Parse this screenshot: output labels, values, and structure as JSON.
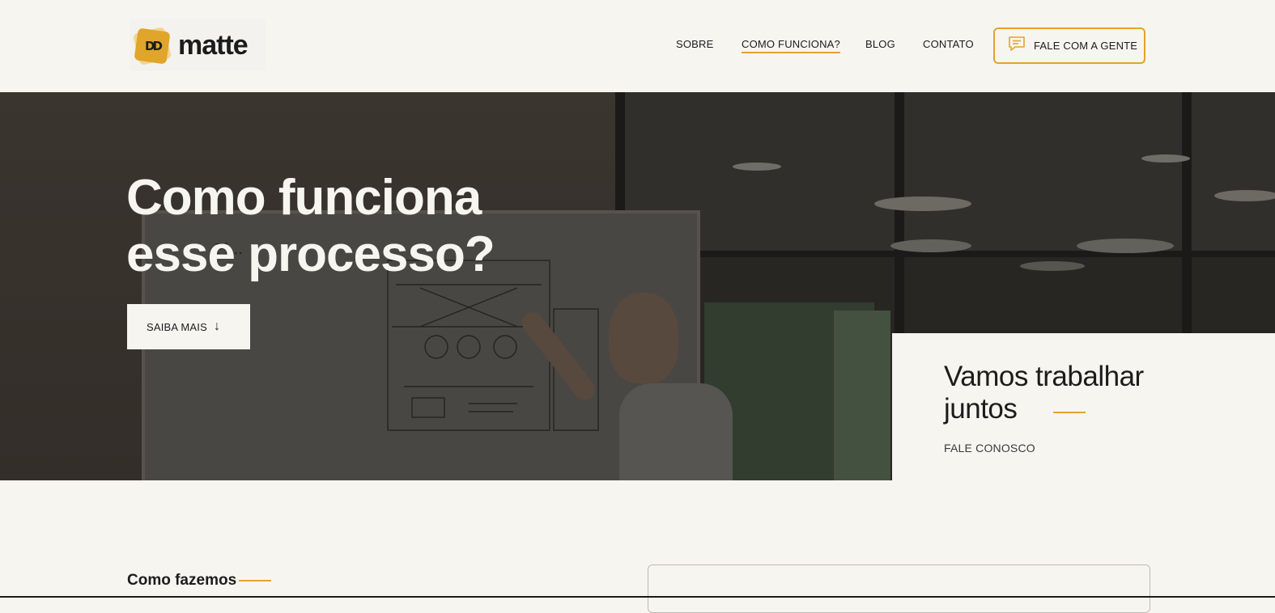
{
  "brand": {
    "name": "matte",
    "mark_text": "DD",
    "accent_color": "#e0a52a",
    "background_color": "#f7f5f0"
  },
  "nav": {
    "items": [
      {
        "label": "SOBRE",
        "active": false
      },
      {
        "label": "COMO FUNCIONA?",
        "active": true
      },
      {
        "label": "BLOG",
        "active": false
      },
      {
        "label": "CONTATO",
        "active": false
      }
    ],
    "cta": {
      "label": "FALE COM A GENTE",
      "icon": "chat-bubble-icon"
    }
  },
  "hero": {
    "title_line1": "Como funciona",
    "title_line2": "esse processo?",
    "button_label": "SAIBA MAIS",
    "button_icon": "arrow-down-icon"
  },
  "work_card": {
    "title_line1": "Vamos trabalhar",
    "title_line2": "juntos",
    "link_label": "FALE CONOSCO"
  },
  "section": {
    "heading": "Como fazemos"
  }
}
